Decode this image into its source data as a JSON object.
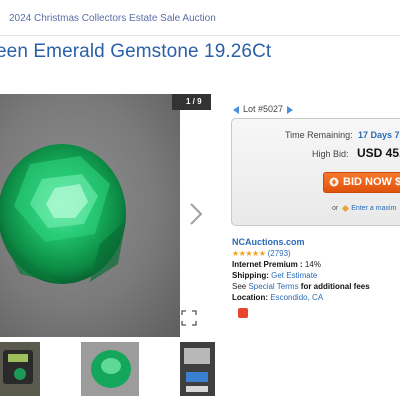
{
  "breadcrumb": "2024 Christmas Collectors Estate Sale Auction",
  "page_title": "een Emerald Gemstone 19.26Ct",
  "gallery": {
    "counter": "1 / 9",
    "next_icon": "chevron-right-icon",
    "expand_icon": "expand-icon",
    "thumbnails": [
      "thumbnail-scale",
      "thumbnail-gem",
      "thumbnail-scale-display"
    ]
  },
  "lot": {
    "label": "Lot #5027",
    "prev_icon": "arrow-left-icon",
    "next_icon": "arrow-right-icon"
  },
  "bid_panel": {
    "time_label": "Time Remaining:",
    "time_value": "17 Days 7",
    "high_bid_label": "High Bid:",
    "high_bid_value": "USD 45.0",
    "button_label": "BID NOW $",
    "max_prefix": "or",
    "max_link": "Enter a maxim",
    "accent_color": "#f06a1e"
  },
  "seller": {
    "name": "NCAuctions.com",
    "stars": "★★★★★",
    "rating_count": "(2793)",
    "premium_label": "Internet Premium :",
    "premium_value": "14%",
    "shipping_label": "Shipping:",
    "shipping_link": "Get Estimate",
    "terms_prefix": "See",
    "terms_link": "Special Terms",
    "terms_suffix": "for additional fees",
    "location_label": "Location:",
    "location_value": "Escondido, CA"
  }
}
